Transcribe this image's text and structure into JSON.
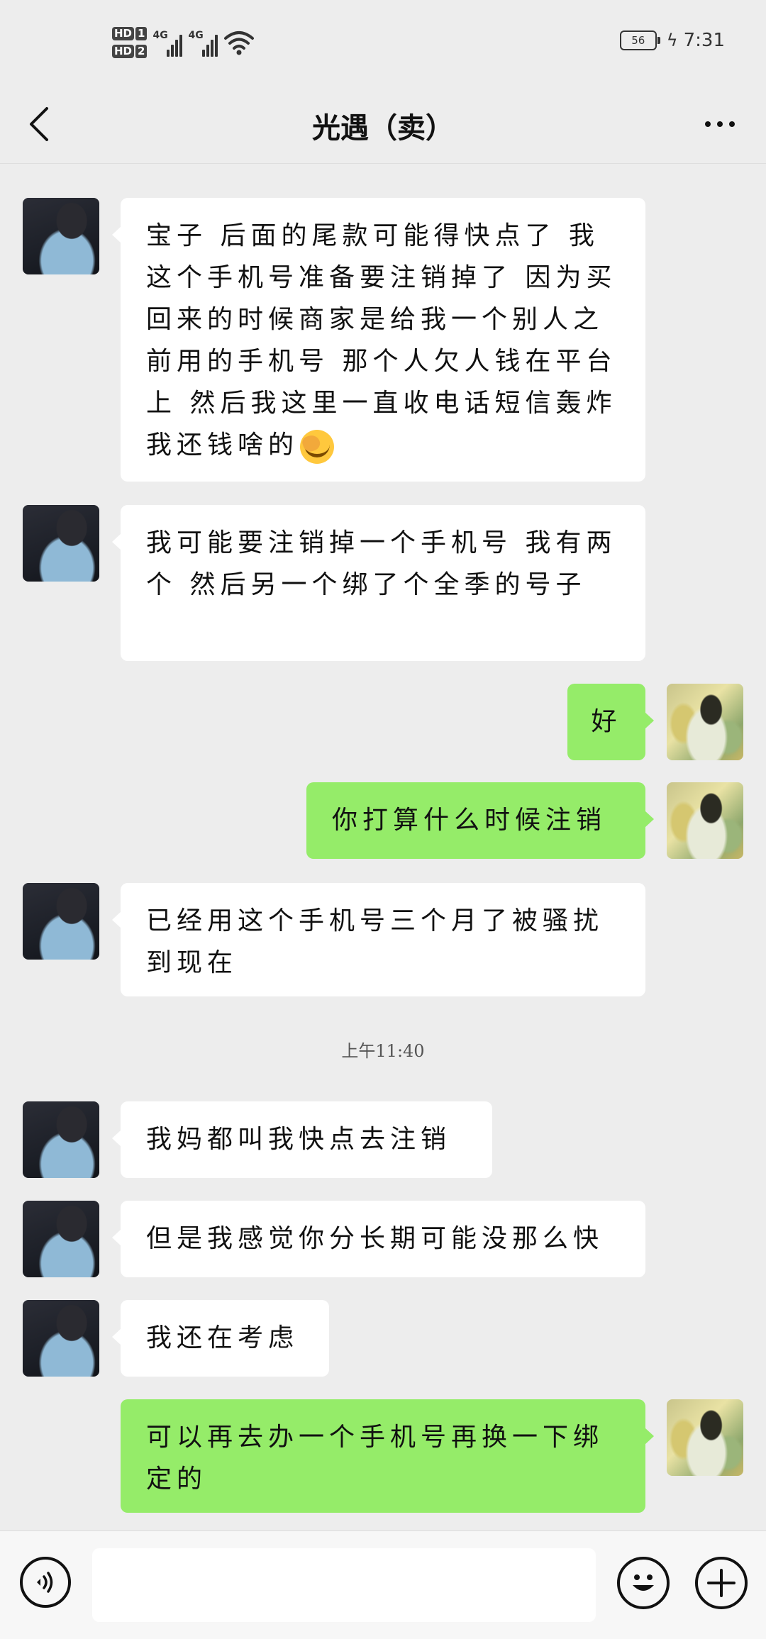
{
  "status_bar": {
    "hd1": "HD",
    "hd1_num": "1",
    "hd2": "HD",
    "hd2_num": "2",
    "network1": "4G",
    "network2": "4G",
    "battery": "56",
    "time": "7:31"
  },
  "header": {
    "title": "光遇（卖）"
  },
  "messages": [
    {
      "sender": "other",
      "text": "宝子 后面的尾款可能得快点了 我这个手机号准备要注销掉了 因为买回来的时候商家是给我一个别人之前用的手机号 那个人欠人钱在平台上 然后我这里一直收电话短信轰炸我还钱啥的",
      "emoji": "facepalm-emoji"
    },
    {
      "sender": "other",
      "text": "我可能要注销掉一个手机号 我有两个 然后另一个绑了个全季的号子"
    },
    {
      "sender": "me",
      "text": "好"
    },
    {
      "sender": "me",
      "text": "你打算什么时候注销"
    },
    {
      "sender": "other",
      "text": "已经用这个手机号三个月了被骚扰到现在"
    },
    {
      "sender": "other",
      "text": "我妈都叫我快点去注销"
    },
    {
      "sender": "other",
      "text": "但是我感觉你分长期可能没那么快"
    },
    {
      "sender": "other",
      "text": "我还在考虑"
    },
    {
      "sender": "me",
      "text": "可以再去办一个手机号再换一下绑定的"
    }
  ],
  "timestamp": "上午11:40",
  "input_bar": {
    "placeholder": "",
    "icons": [
      "voice-icon",
      "emoji-icon",
      "plus-icon"
    ]
  }
}
